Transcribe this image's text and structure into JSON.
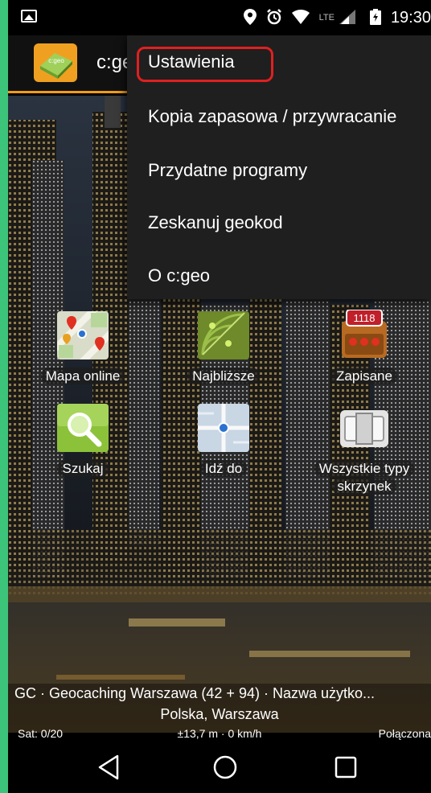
{
  "status_bar": {
    "time": "19:30",
    "network": "LTE",
    "icons": [
      "image-notification-icon",
      "location-icon",
      "alarm-icon",
      "wifi-icon",
      "signal-icon",
      "battery-icon"
    ]
  },
  "app": {
    "title": "c:geo"
  },
  "menu": {
    "items": [
      "Ustawienia",
      "Kopia zapasowa / przywracanie",
      "Przydatne programy",
      "Zeskanuj geokod",
      "O c:geo"
    ],
    "highlight_color": "#e02020"
  },
  "tiles": [
    {
      "label": "Mapa online",
      "icon": "map-icon"
    },
    {
      "label": "Najbliższe",
      "icon": "radar-icon"
    },
    {
      "label": "Zapisane",
      "icon": "stored-caches-icon",
      "badge": "1118"
    },
    {
      "label": "Szukaj",
      "icon": "search-icon"
    },
    {
      "label": "Idź do",
      "icon": "goto-icon"
    },
    {
      "label": "Wszystkie typy skrzynek",
      "icon": "cache-types-icon"
    }
  ],
  "info": {
    "line1": "GC · Geocaching Warszawa (42 + 94) · Nazwa użytko...",
    "line2": "Polska, Warszawa",
    "satellites": "Sat: 0/20",
    "accuracy": "±13,7 m · 0 km/h",
    "connection": "Połączona"
  },
  "colors": {
    "accent": "#f39c12",
    "frame": "#3cc47a"
  }
}
